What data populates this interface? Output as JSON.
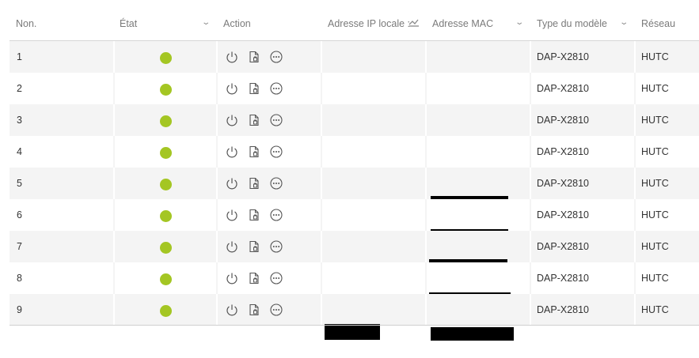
{
  "header": {
    "col_no": "Non.",
    "col_state": "État",
    "col_action": "Action",
    "col_ip": "Adresse IP locale :",
    "col_mac": "Adresse MAC",
    "col_model": "Type du modèle",
    "col_network": "Réseau"
  },
  "colors": {
    "online": "#a4c623",
    "row_alt": "#f4f4f4"
  },
  "icons": {
    "power": "power-icon",
    "config": "config-file-icon",
    "more": "more-options-icon"
  },
  "rows": [
    {
      "no": "1",
      "model": "DAP-X2810",
      "network": "HUTC",
      "status": "online"
    },
    {
      "no": "2",
      "model": "DAP-X2810",
      "network": "HUTC",
      "status": "online"
    },
    {
      "no": "3",
      "model": "DAP-X2810",
      "network": "HUTC",
      "status": "online"
    },
    {
      "no": "4",
      "model": "DAP-X2810",
      "network": "HUTC",
      "status": "online"
    },
    {
      "no": "5",
      "model": "DAP-X2810",
      "network": "HUTC",
      "status": "online"
    },
    {
      "no": "6",
      "model": "DAP-X2810",
      "network": "HUTC",
      "status": "online"
    },
    {
      "no": "7",
      "model": "DAP-X2810",
      "network": "HUTC",
      "status": "online"
    },
    {
      "no": "8",
      "model": "DAP-X2810",
      "network": "HUTC",
      "status": "online"
    },
    {
      "no": "9",
      "model": "DAP-X2810",
      "network": "HUTC",
      "status": "online"
    }
  ]
}
